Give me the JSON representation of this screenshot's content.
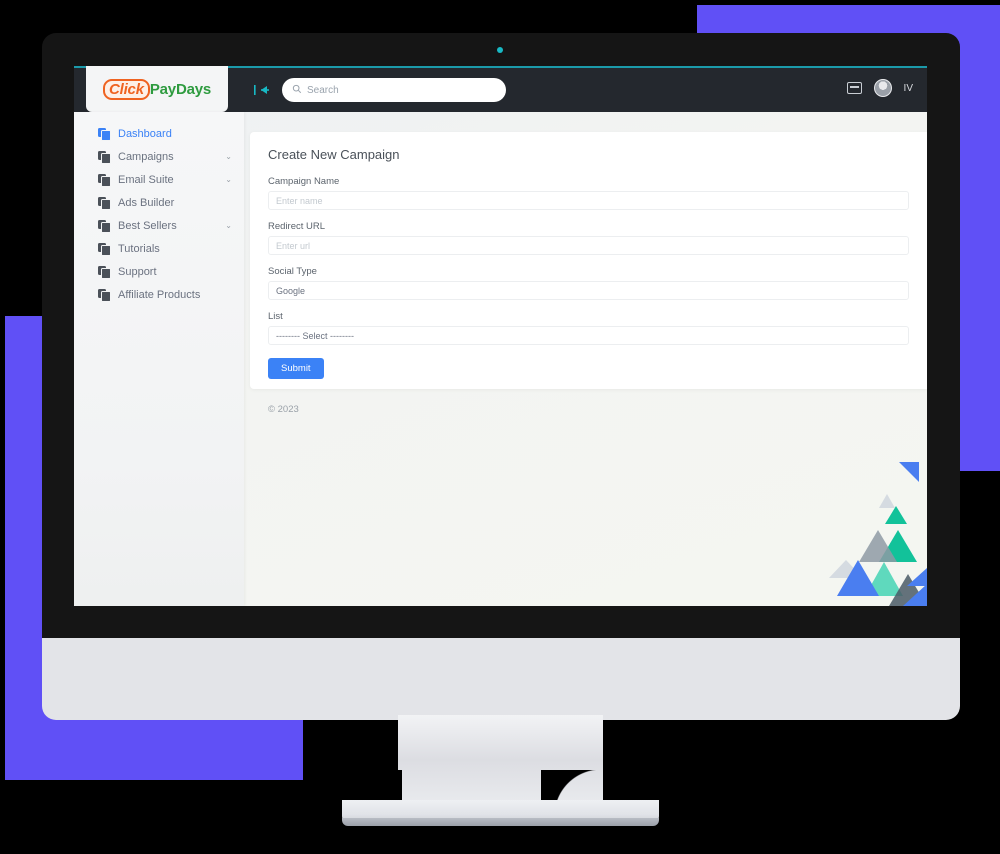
{
  "app": {
    "logo": {
      "part1": "Click",
      "part2": "Pay",
      "part3": "Days"
    },
    "top_line_color": "#1b9aaa",
    "topbar_bg": "#24282e"
  },
  "topbar": {
    "collapse_icon": "collapse-sidebar-icon",
    "search": {
      "placeholder": "Search",
      "value": "",
      "icon": "search-icon"
    },
    "card_icon": "card-icon",
    "avatar_icon": "user-avatar-icon",
    "user_label": "IV"
  },
  "sidebar": {
    "items": [
      {
        "label": "Dashboard",
        "active": true,
        "chevron": false
      },
      {
        "label": "Campaigns",
        "active": false,
        "chevron": true
      },
      {
        "label": "Email Suite",
        "active": false,
        "chevron": true
      },
      {
        "label": "Ads Builder",
        "active": false,
        "chevron": false
      },
      {
        "label": "Best Sellers",
        "active": false,
        "chevron": true
      },
      {
        "label": "Tutorials",
        "active": false,
        "chevron": false
      },
      {
        "label": "Support",
        "active": false,
        "chevron": false
      },
      {
        "label": "Affiliate Products",
        "active": false,
        "chevron": false
      }
    ],
    "chevron_glyph": "⌄",
    "active_color": "#3b82f6"
  },
  "main": {
    "title": "Create New Campaign",
    "fields": [
      {
        "label": "Campaign Name",
        "value": "",
        "placeholder": "Enter name",
        "type": "text"
      },
      {
        "label": "Redirect URL",
        "value": "",
        "placeholder": "Enter url",
        "type": "text"
      },
      {
        "label": "Social Type",
        "value": "Google",
        "placeholder": "",
        "type": "select"
      },
      {
        "label": "List",
        "value": "-------- Select --------",
        "placeholder": "",
        "type": "select"
      }
    ],
    "submit_label": "Submit",
    "submit_color": "#3b82f6"
  },
  "footer": {
    "copyright": "© 2023"
  },
  "decor": {
    "purple": "#6050f6",
    "triangle_blue": "#4a7ef0",
    "triangle_teal": "#12c29a",
    "triangle_gray": "#8e9aa4",
    "triangle_mint": "#5fd9bd",
    "triangle_pale": "#d5dbe1"
  }
}
